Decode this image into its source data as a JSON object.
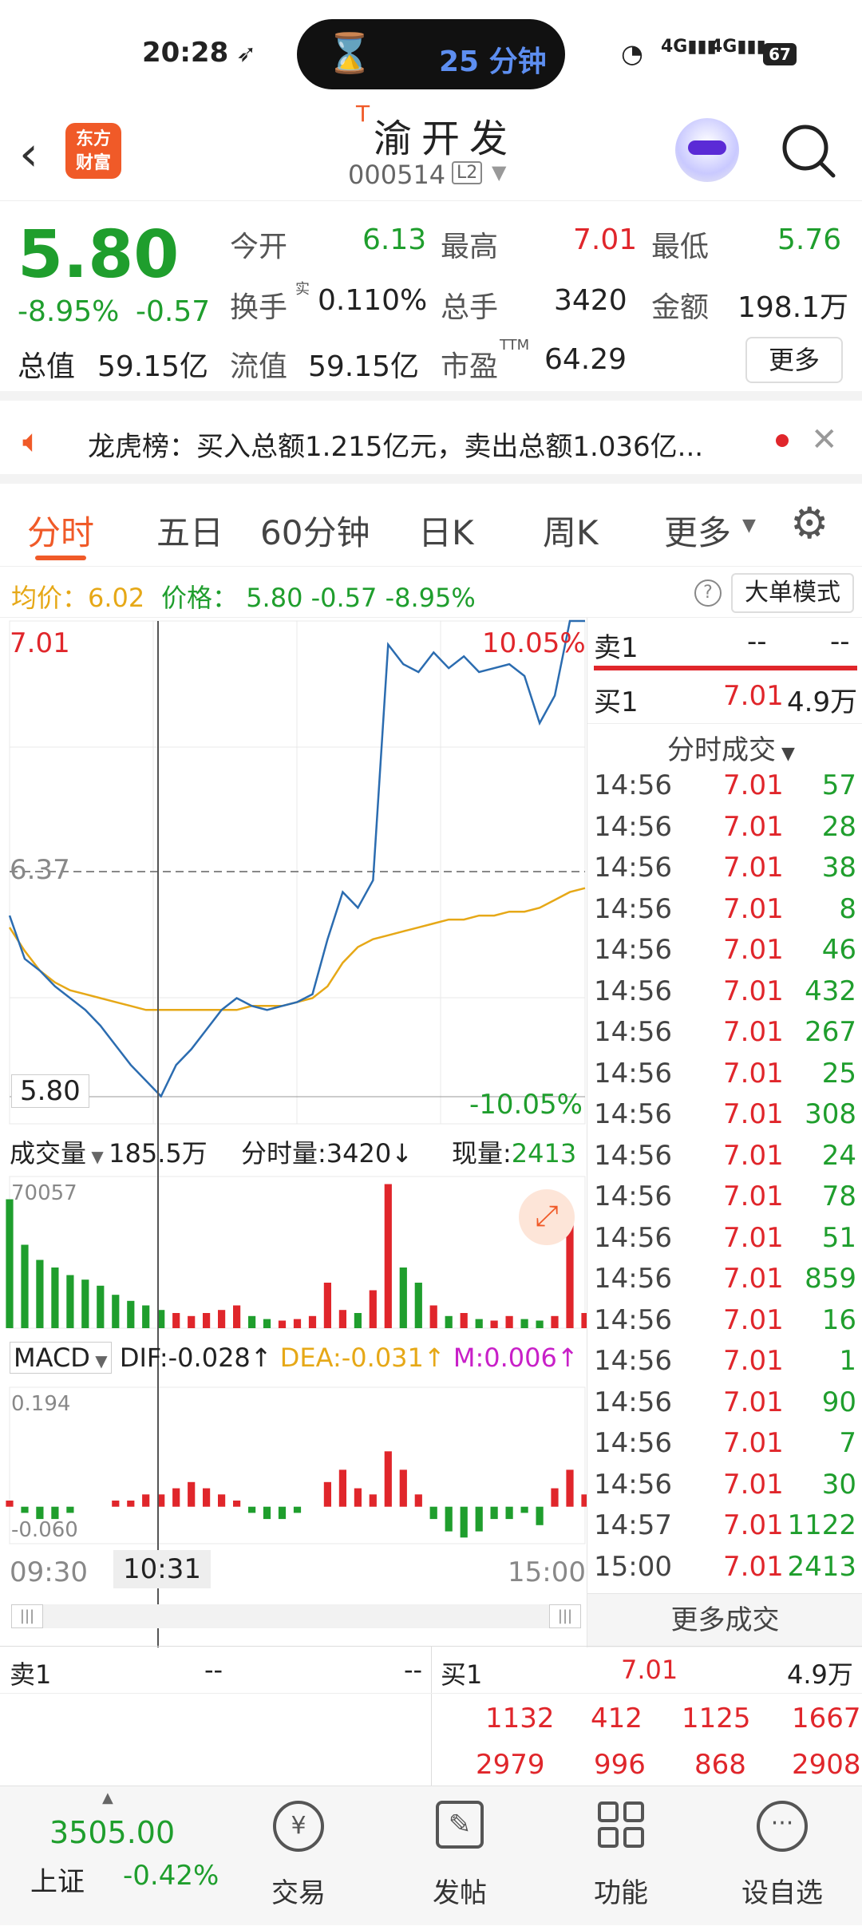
{
  "status": {
    "time": "20:28",
    "timer": "25 分钟",
    "battery": "67",
    "net1": "4G",
    "net2": "4G"
  },
  "header": {
    "logo_line1": "东方",
    "logo_line2": "财富",
    "t_mark": "T",
    "stock_name": "渝开发",
    "stock_code": "000514",
    "level": "L2"
  },
  "quote": {
    "price": "5.80",
    "pct": "-8.95%",
    "chg": "-0.57",
    "open_label": "今开",
    "open": "6.13",
    "high_label": "最高",
    "high": "7.01",
    "low_label": "最低",
    "low": "5.76",
    "turnover_label": "换手",
    "turnover_sup": "实",
    "turnover": "0.110%",
    "vol_label": "总手",
    "vol": "3420",
    "amt_label": "金额",
    "amt": "198.1万",
    "mktcap_label": "总值",
    "mktcap": "59.15亿",
    "float_label": "流值",
    "float": "59.15亿",
    "pe_label": "市盈",
    "pe_sup": "TTM",
    "pe": "64.29",
    "more": "更多"
  },
  "notice": {
    "text": "龙虎榜：买入总额1.215亿元，卖出总额1.036亿..."
  },
  "tabs": [
    "分时",
    "五日",
    "60分钟",
    "日K",
    "周K",
    "更多"
  ],
  "info": {
    "avg_label": "均价：",
    "avg": "6.02",
    "price_label": "价格：",
    "price": "5.80",
    "chg": "-0.57",
    "pct": "-8.95%",
    "mode": "大单模式"
  },
  "chart": {
    "y_top": "7.01",
    "pct_top": "10.05%",
    "y_mid": "6.37",
    "y_bot": "5.80",
    "pct_bot": "-10.05%",
    "vol_label": "成交量",
    "vol_total": "185.5万",
    "vol_now_label": "分时量:3420↓",
    "vol_cur_label": "现量:",
    "vol_cur": "2413",
    "vol_max": "70057",
    "macd_label": "MACD",
    "dif": "DIF:-0.028↑",
    "dea": "DEA:-0.031↑",
    "m": "M:0.006↑",
    "macd_top": "0.194",
    "macd_bot": "-0.060",
    "t_start": "09:30",
    "t_cursor": "10:31",
    "t_end": "15:00"
  },
  "chart_data": {
    "type": "line",
    "price": [
      6.26,
      6.15,
      6.12,
      6.08,
      6.05,
      6.02,
      5.98,
      5.93,
      5.88,
      5.84,
      5.8,
      5.88,
      5.92,
      5.97,
      6.02,
      6.05,
      6.03,
      6.02,
      6.03,
      6.04,
      6.06,
      6.2,
      6.32,
      6.28,
      6.35,
      6.95,
      6.9,
      6.88,
      6.93,
      6.89,
      6.92,
      6.88,
      6.89,
      6.9,
      6.87,
      6.75,
      6.82,
      7.01,
      7.01
    ],
    "avg": [
      6.23,
      6.17,
      6.12,
      6.09,
      6.07,
      6.06,
      6.05,
      6.04,
      6.03,
      6.02,
      6.02,
      6.02,
      6.02,
      6.02,
      6.02,
      6.02,
      6.03,
      6.03,
      6.03,
      6.04,
      6.05,
      6.08,
      6.14,
      6.18,
      6.2,
      6.21,
      6.22,
      6.23,
      6.24,
      6.25,
      6.25,
      6.26,
      6.26,
      6.27,
      6.27,
      6.28,
      6.3,
      6.32,
      6.33
    ],
    "volume": [
      0.85,
      0.55,
      0.45,
      0.4,
      0.35,
      0.32,
      0.28,
      0.22,
      0.18,
      0.15,
      0.12,
      0.1,
      0.08,
      0.1,
      0.12,
      0.15,
      0.08,
      0.06,
      0.05,
      0.06,
      0.08,
      0.3,
      0.12,
      0.1,
      0.25,
      0.95,
      0.4,
      0.3,
      0.15,
      0.08,
      0.1,
      0.06,
      0.05,
      0.08,
      0.06,
      0.05,
      0.08,
      0.75,
      0.1
    ],
    "macd": [
      0.01,
      -0.01,
      -0.02,
      -0.02,
      -0.01,
      0.0,
      0.0,
      0.01,
      0.01,
      0.02,
      0.02,
      0.03,
      0.04,
      0.03,
      0.02,
      0.01,
      -0.01,
      -0.02,
      -0.02,
      -0.01,
      0.0,
      0.04,
      0.06,
      0.03,
      0.02,
      0.09,
      0.06,
      0.02,
      -0.02,
      -0.04,
      -0.05,
      -0.04,
      -0.02,
      -0.02,
      -0.01,
      -0.03,
      0.03,
      0.06,
      0.02
    ]
  },
  "trades": {
    "sell_label": "卖1",
    "sell_p": "--",
    "sell_v": "--",
    "buy_label": "买1",
    "buy_p": "7.01",
    "buy_v": "4.9万",
    "section": "分时成交",
    "more": "更多成交",
    "rows": [
      [
        "14:56",
        "7.01",
        "57"
      ],
      [
        "14:56",
        "7.01",
        "28"
      ],
      [
        "14:56",
        "7.01",
        "38"
      ],
      [
        "14:56",
        "7.01",
        "8"
      ],
      [
        "14:56",
        "7.01",
        "46"
      ],
      [
        "14:56",
        "7.01",
        "432"
      ],
      [
        "14:56",
        "7.01",
        "267"
      ],
      [
        "14:56",
        "7.01",
        "25"
      ],
      [
        "14:56",
        "7.01",
        "308"
      ],
      [
        "14:56",
        "7.01",
        "24"
      ],
      [
        "14:56",
        "7.01",
        "78"
      ],
      [
        "14:56",
        "7.01",
        "51"
      ],
      [
        "14:56",
        "7.01",
        "859"
      ],
      [
        "14:56",
        "7.01",
        "16"
      ],
      [
        "14:56",
        "7.01",
        "1"
      ],
      [
        "14:56",
        "7.01",
        "90"
      ],
      [
        "14:56",
        "7.01",
        "7"
      ],
      [
        "14:56",
        "7.01",
        "30"
      ],
      [
        "14:57",
        "7.01",
        "1122"
      ],
      [
        "15:00",
        "7.01",
        "2413"
      ]
    ]
  },
  "orderbook": {
    "sell_label": "卖1",
    "sell_p": "--",
    "sell_v": "--",
    "buy_label": "买1",
    "buy_p": "7.01",
    "buy_v": "4.9万",
    "r1": [
      "1132",
      "412",
      "1125",
      "1667"
    ],
    "r2": [
      "2979",
      "996",
      "868",
      "2908"
    ]
  },
  "nav": {
    "index_val": "3505.00",
    "index_name": "上证",
    "index_pct": "-0.42%",
    "items": [
      "交易",
      "发帖",
      "功能",
      "设自选"
    ]
  }
}
